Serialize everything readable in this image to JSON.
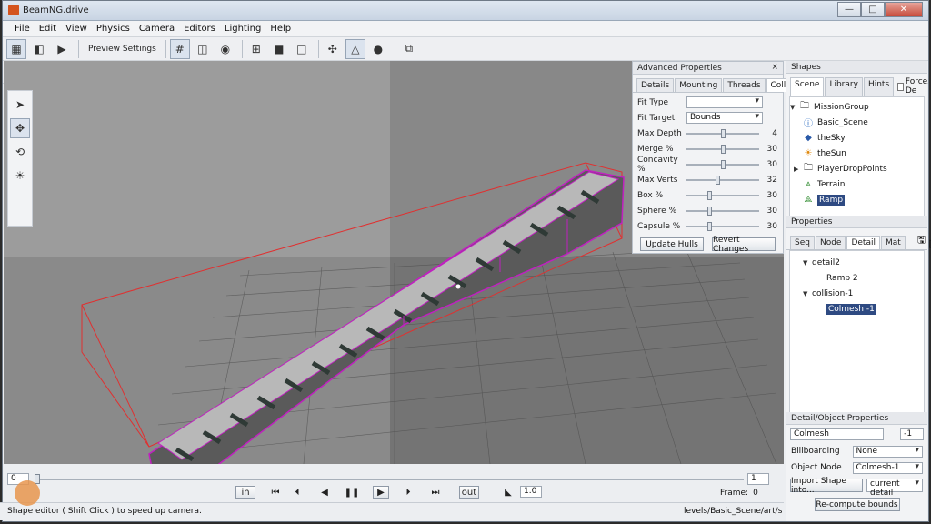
{
  "window": {
    "title": "BeamNG.drive",
    "min": "—",
    "max": "□",
    "close": "✕"
  },
  "menu": [
    "File",
    "Edit",
    "View",
    "Physics",
    "Camera",
    "Editors",
    "Lighting",
    "Help"
  ],
  "toolbar1": {
    "preview_settings": "Preview Settings"
  },
  "advanced": {
    "title": "Advanced Properties",
    "close": "×",
    "tabs": [
      "Details",
      "Mounting",
      "Threads",
      "Collision"
    ],
    "fit_type_label": "Fit Type",
    "fit_type_value": "",
    "fit_target_label": "Fit Target",
    "fit_target_value": "Bounds",
    "sliders": [
      {
        "label": "Max Depth",
        "value": "4",
        "pos": 0.5
      },
      {
        "label": "Merge %",
        "value": "30",
        "pos": 0.5
      },
      {
        "label": "Concavity %",
        "value": "30",
        "pos": 0.5
      },
      {
        "label": "Max Verts",
        "value": "32",
        "pos": 0.42
      },
      {
        "label": "Box %",
        "value": "30",
        "pos": 0.3
      },
      {
        "label": "Sphere %",
        "value": "30",
        "pos": 0.3
      },
      {
        "label": "Capsule %",
        "value": "30",
        "pos": 0.3
      }
    ],
    "update_hulls": "Update Hulls",
    "revert_changes": "Revert Changes"
  },
  "shapes": {
    "title": "Shapes",
    "tabs": [
      "Scene",
      "Library",
      "Hints"
    ],
    "force_label": "Force De",
    "tree": {
      "root": "MissionGroup",
      "children": [
        "Basic_Scene",
        "theSky",
        "theSun",
        "PlayerDropPoints",
        "Terrain",
        "Ramp"
      ]
    }
  },
  "properties": {
    "title": "Properties",
    "tabs": [
      "Seq",
      "Node",
      "Detail",
      "Mat"
    ],
    "tree": {
      "detail": "detail2",
      "detail_child": "Ramp 2",
      "collision": "collision-1",
      "collision_child": "Colmesh -1"
    }
  },
  "detail_props": {
    "title": "Detail/Object Properties",
    "name_value": "Colmesh",
    "size_value": "-1",
    "billboarding_label": "Billboarding",
    "billboarding_value": "None",
    "object_node_label": "Object Node",
    "object_node_value": "Colmesh-1",
    "import_shape": "Import Shape into...",
    "current_detail": "current detail",
    "recompute": "Re-compute bounds"
  },
  "timeline": {
    "start": "0",
    "end": "1",
    "in": "in",
    "out": "out",
    "speed": "1.0",
    "frame_label": "Frame:",
    "frame_value": "0"
  },
  "status": {
    "left": "Shape editor ( Shift Click ) to speed up camera.",
    "right": "levels/Basic_Scene/art/shap"
  }
}
